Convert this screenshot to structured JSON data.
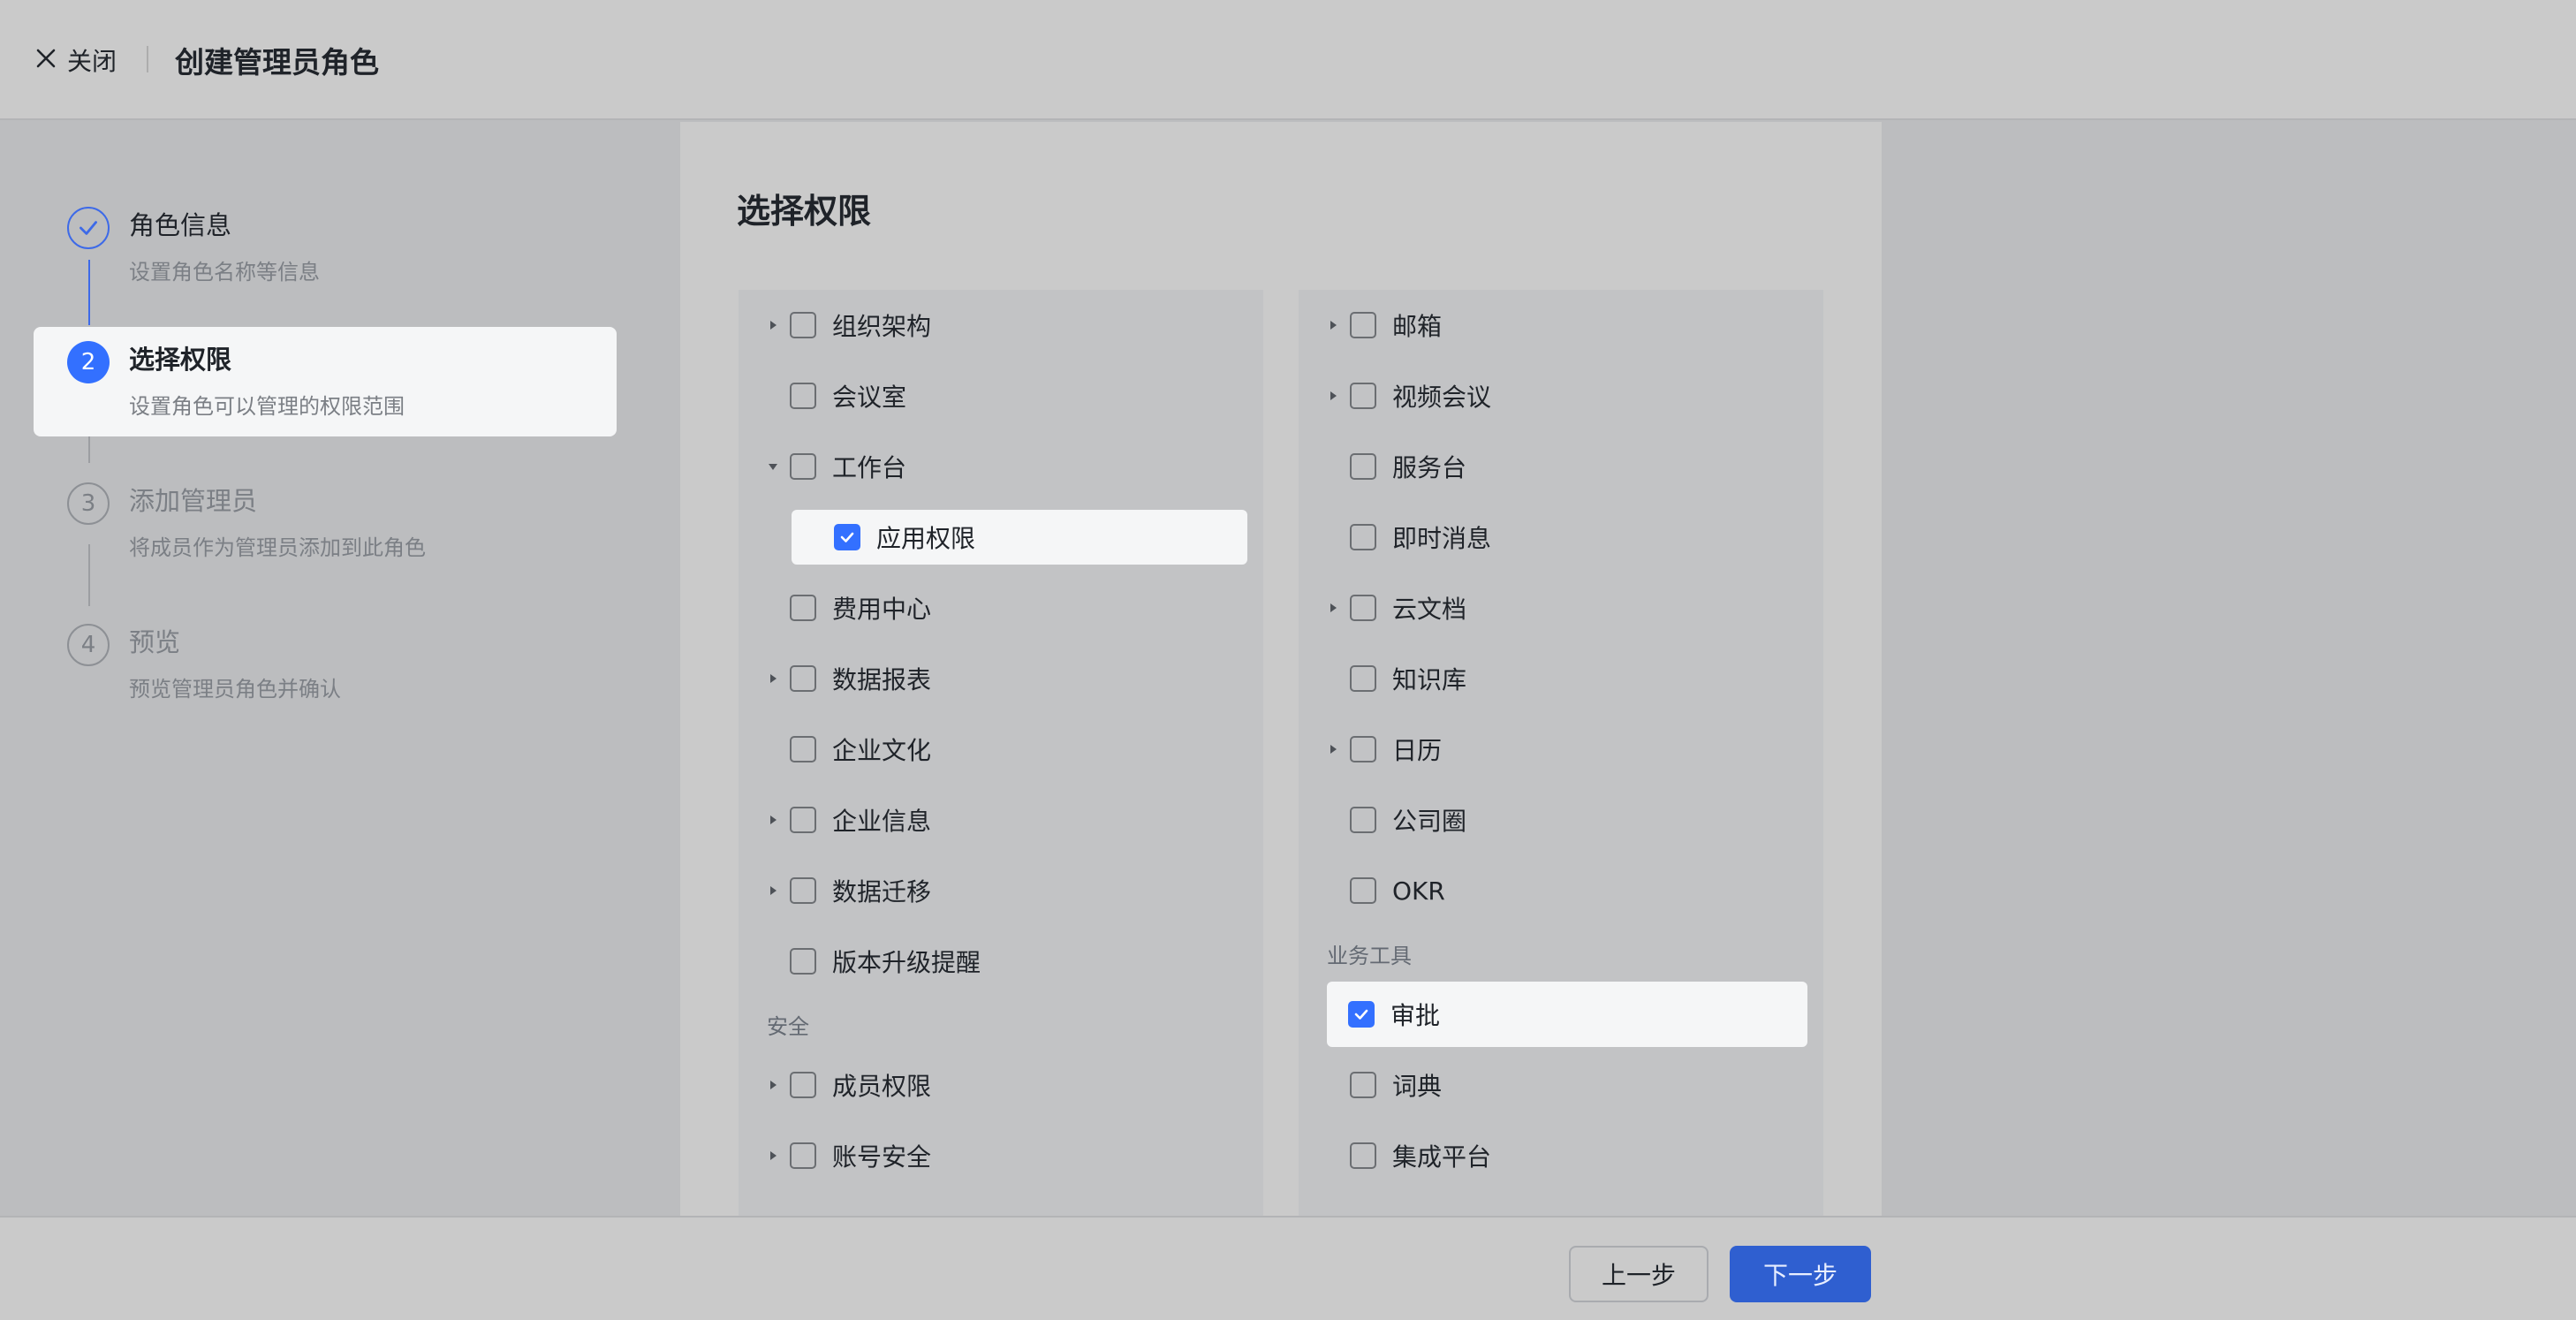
{
  "header": {
    "close_label": "关闭",
    "title": "创建管理员角色"
  },
  "steps": [
    {
      "number": "",
      "title": "角色信息",
      "desc": "设置角色名称等信息",
      "state": "done"
    },
    {
      "number": "2",
      "title": "选择权限",
      "desc": "设置角色可以管理的权限范围",
      "state": "active"
    },
    {
      "number": "3",
      "title": "添加管理员",
      "desc": "将成员作为管理员添加到此角色",
      "state": "pending"
    },
    {
      "number": "4",
      "title": "预览",
      "desc": "预览管理员角色并确认",
      "state": "pending"
    }
  ],
  "main": {
    "title": "选择权限",
    "left_column": {
      "items": [
        {
          "label": "组织架构",
          "arrow": "collapsed",
          "checked": false
        },
        {
          "label": "会议室",
          "arrow": "none",
          "checked": false
        },
        {
          "label": "工作台",
          "arrow": "expanded",
          "checked": false
        },
        {
          "label": "应用权限",
          "arrow": "none",
          "checked": true,
          "child": true
        },
        {
          "label": "费用中心",
          "arrow": "none",
          "checked": false
        },
        {
          "label": "数据报表",
          "arrow": "collapsed",
          "checked": false
        },
        {
          "label": "企业文化",
          "arrow": "none",
          "checked": false
        },
        {
          "label": "企业信息",
          "arrow": "collapsed",
          "checked": false
        },
        {
          "label": "数据迁移",
          "arrow": "collapsed",
          "checked": false
        },
        {
          "label": "版本升级提醒",
          "arrow": "none",
          "checked": false
        }
      ],
      "group_label": "安全",
      "group_items": [
        {
          "label": "成员权限",
          "arrow": "collapsed",
          "checked": false
        },
        {
          "label": "账号安全",
          "arrow": "collapsed",
          "checked": false
        }
      ]
    },
    "right_column": {
      "items": [
        {
          "label": "邮箱",
          "arrow": "collapsed",
          "checked": false
        },
        {
          "label": "视频会议",
          "arrow": "collapsed",
          "checked": false
        },
        {
          "label": "服务台",
          "arrow": "none",
          "checked": false
        },
        {
          "label": "即时消息",
          "arrow": "none",
          "checked": false
        },
        {
          "label": "云文档",
          "arrow": "collapsed",
          "checked": false
        },
        {
          "label": "知识库",
          "arrow": "none",
          "checked": false
        },
        {
          "label": "日历",
          "arrow": "collapsed",
          "checked": false
        },
        {
          "label": "公司圈",
          "arrow": "none",
          "checked": false
        },
        {
          "label": "OKR",
          "arrow": "none",
          "checked": false
        }
      ],
      "group_label": "业务工具",
      "group_items": [
        {
          "label": "审批",
          "arrow": "none",
          "checked": true
        },
        {
          "label": "词典",
          "arrow": "none",
          "checked": false
        },
        {
          "label": "集成平台",
          "arrow": "none",
          "checked": false
        }
      ]
    }
  },
  "footer": {
    "prev_label": "上一步",
    "next_label": "下一步"
  },
  "colors": {
    "accent": "#3370ff",
    "primary_button": "#2f5fd0"
  }
}
